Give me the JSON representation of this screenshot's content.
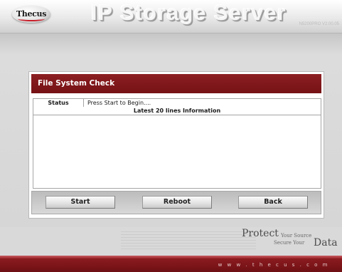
{
  "header": {
    "logo_text": "Thecus",
    "title": "IP Storage Server",
    "version": "N5200PRO V2.00.05"
  },
  "panel": {
    "title": "File System Check",
    "status_label": "Status",
    "status_value": "Press Start to Begin....",
    "info_header": "Latest 20 lines Information",
    "buttons": {
      "start": "Start",
      "reboot": "Reboot",
      "back": "Back"
    }
  },
  "footer": {
    "protect": "Protect",
    "your_source": "Your Source",
    "secure_your": "Secure Your",
    "data": "Data",
    "url": "w w w . t h e c u s . c o m"
  },
  "colors": {
    "accent": "#7a1418",
    "background": "#d9d9d9"
  }
}
